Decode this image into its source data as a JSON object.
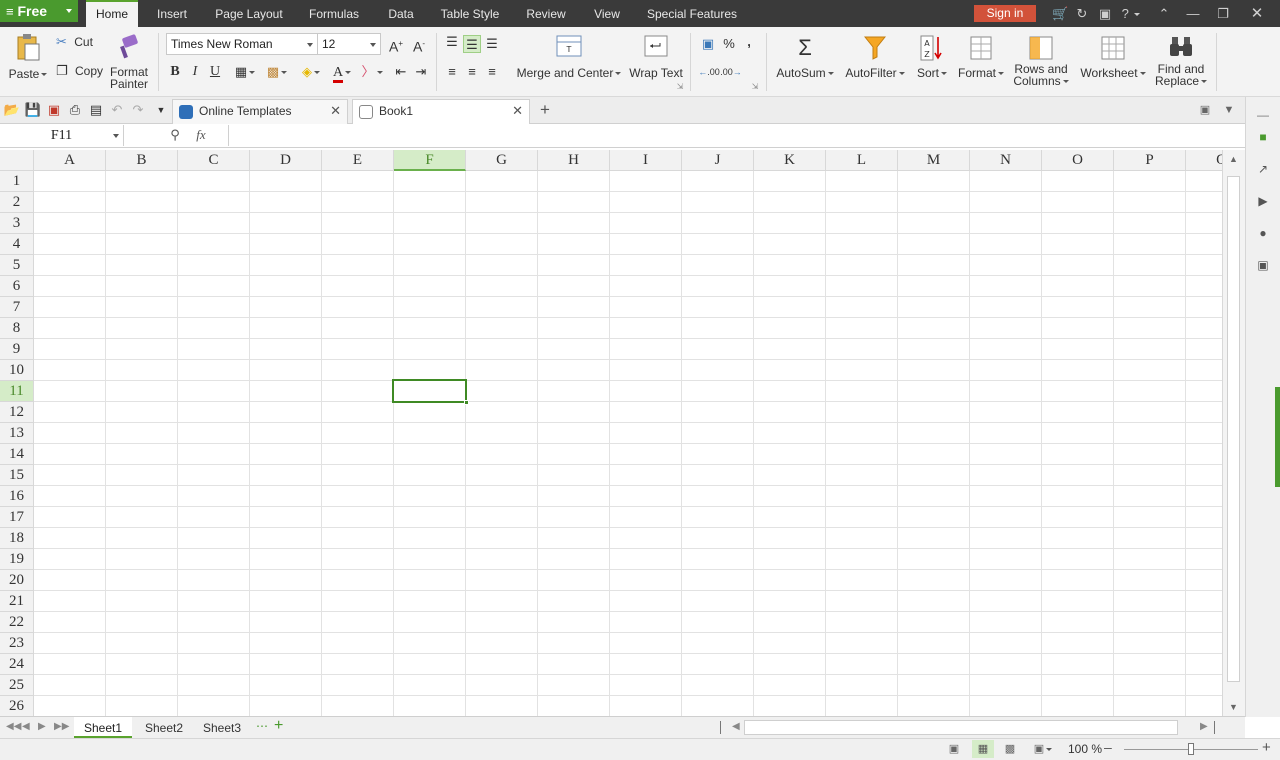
{
  "app": {
    "free_label": "Free",
    "sign_in": "Sign in"
  },
  "menu": [
    {
      "label": "Home",
      "active": true
    },
    {
      "label": "Insert"
    },
    {
      "label": "Page Layout"
    },
    {
      "label": "Formulas"
    },
    {
      "label": "Data"
    },
    {
      "label": "Table Style"
    },
    {
      "label": "Review"
    },
    {
      "label": "View"
    },
    {
      "label": "Special Features"
    }
  ],
  "ribbon": {
    "paste": "Paste",
    "cut": "Cut",
    "copy": "Copy",
    "format_painter_1": "Format",
    "format_painter_2": "Painter",
    "font_name": "Times New Roman",
    "font_size": "12",
    "bold": "B",
    "italic": "I",
    "underline": "U",
    "merge_center": "Merge and Center",
    "wrap_text": "Wrap Text",
    "percent": "%",
    "comma": ",",
    "dec_inc": ".00",
    "dec_dec": ".00",
    "autosum": "AutoSum",
    "autofilter": "AutoFilter",
    "sort": "Sort",
    "format": "Format",
    "rows_cols_1": "Rows and",
    "rows_cols_2": "Columns",
    "worksheet": "Worksheet",
    "find_replace_1": "Find and",
    "find_replace_2": "Replace"
  },
  "tabs": [
    {
      "label": "Online Templates"
    },
    {
      "label": "Book1"
    }
  ],
  "formula_bar": {
    "name_box": "F11",
    "fx": "fx",
    "value": ""
  },
  "grid": {
    "columns": [
      "A",
      "B",
      "C",
      "D",
      "E",
      "F",
      "G",
      "H",
      "I",
      "J",
      "K",
      "L",
      "M",
      "N",
      "O",
      "P",
      "Q"
    ],
    "rows": [
      "1",
      "2",
      "3",
      "4",
      "5",
      "6",
      "7",
      "8",
      "9",
      "10",
      "11",
      "12",
      "13",
      "14",
      "15",
      "16",
      "17",
      "18",
      "19",
      "20",
      "21",
      "22",
      "23",
      "24",
      "25",
      "26"
    ],
    "selected_col": "F",
    "selected_row": "11"
  },
  "sheets": [
    {
      "label": "Sheet1",
      "active": true
    },
    {
      "label": "Sheet2"
    },
    {
      "label": "Sheet3"
    }
  ],
  "status": {
    "zoom": "100 %"
  },
  "colors": {
    "accent": "#5aa32e",
    "menubar": "#3a3a3a",
    "signin": "#d2523a",
    "selection": "#3f8a24"
  }
}
